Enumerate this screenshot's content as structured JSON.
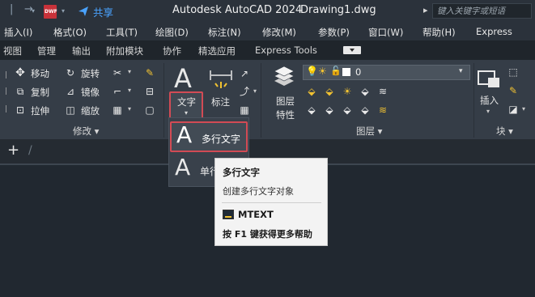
{
  "titlebar": {
    "dwf_badge": "DWF",
    "share": "共享",
    "app_title": "Autodesk AutoCAD 2024",
    "doc_name": "Drawing1.dwg",
    "search_placeholder": "键入关键字或短语"
  },
  "menubar": {
    "items": [
      "插入(I)",
      "格式(O)",
      "工具(T)",
      "绘图(D)",
      "标注(N)",
      "修改(M)",
      "参数(P)",
      "窗口(W)",
      "帮助(H)",
      "Express"
    ]
  },
  "ribbon_tabs": {
    "items": [
      "视图",
      "管理",
      "输出",
      "附加模块",
      "协作",
      "精选应用",
      "Express Tools"
    ]
  },
  "modify_panel": {
    "title": "修改",
    "move": "移动",
    "rotate": "旋转",
    "copy": "复制",
    "mirror": "镜像",
    "stretch": "拉伸",
    "scale": "缩放"
  },
  "annotation_panel": {
    "text": "文字",
    "dimension": "标注",
    "text_glyph": "A"
  },
  "layers_panel": {
    "title": "图层",
    "properties_line1": "图层",
    "properties_line2": "特性",
    "current_layer": "0"
  },
  "block_panel": {
    "title": "块",
    "insert": "插入"
  },
  "text_dropdown": {
    "multiline": "多行文字",
    "single_partial": "单行"
  },
  "tooltip": {
    "title": "多行文字",
    "description": "创建多行文字对象",
    "command": "MTEXT",
    "help_prefix": "按 ",
    "help_key": "F1",
    "help_suffix": " 键获得更多帮助"
  },
  "command_area": {
    "plus": "+",
    "slash": "/"
  },
  "colors": {
    "highlight_border": "#d24b55",
    "ribbon_bg": "#353d47",
    "canvas_bg": "#212830",
    "tooltip_bg": "#f3f3f3"
  }
}
